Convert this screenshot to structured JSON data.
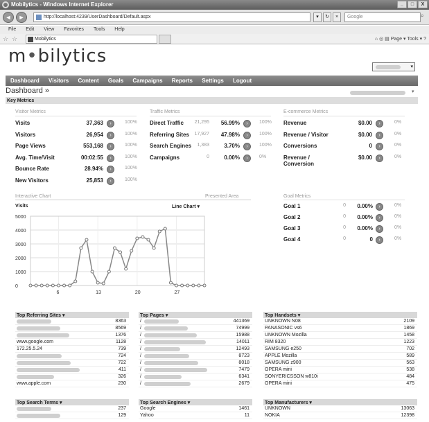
{
  "window": {
    "title": "Mobilytics - Windows Internet Explorer",
    "min": "_",
    "max": "□",
    "close": "X"
  },
  "address": {
    "url": "http://localhost:4239/UserDashboard/Default.aspx",
    "search_placeholder": "Google",
    "back": "◄",
    "fwd": "►"
  },
  "menu": [
    "File",
    "Edit",
    "View",
    "Favorites",
    "Tools",
    "Help"
  ],
  "tab": {
    "label": "Mobilytics"
  },
  "toolbar_right": "Page ▾  Tools ▾",
  "brand": {
    "logo_pre": "m",
    "logo_dot": "•",
    "logo_post": "bilytics"
  },
  "nav": [
    "Dashboard",
    "Visitors",
    "Content",
    "Goals",
    "Campaigns",
    "Reports",
    "Settings",
    "Logout"
  ],
  "breadcrumb": "Dashboard »",
  "key_metrics": "Key Metrics",
  "visitor": {
    "heading": "Visitor Metrics",
    "rows": [
      {
        "label": "Visits",
        "value": "37,363",
        "pct": "100%"
      },
      {
        "label": "Visitors",
        "value": "26,954",
        "pct": "100%"
      },
      {
        "label": "Page Views",
        "value": "553,168",
        "pct": "100%"
      },
      {
        "label": "Avg. Time/Visit",
        "value": "00:02:55",
        "pct": "100%"
      },
      {
        "label": "Bounce Rate",
        "value": "28.94%",
        "pct": "100%"
      },
      {
        "label": "New Visitors",
        "value": "25,853",
        "pct": "100%"
      }
    ]
  },
  "traffic": {
    "heading": "Traffic Metrics",
    "rows": [
      {
        "label": "Direct Traffic",
        "mini": "21,295",
        "value": "56.99%",
        "pct": "100%"
      },
      {
        "label": "Referring Sites",
        "mini": "17,927",
        "value": "47.98%",
        "pct": "100%"
      },
      {
        "label": "Search Engines",
        "mini": "1,383",
        "value": "3.70%",
        "pct": "100%"
      },
      {
        "label": "Campaigns",
        "mini": "0",
        "value": "0.00%",
        "pct": "0%"
      }
    ]
  },
  "ecom": {
    "heading": "E-commerce Metrics",
    "rows": [
      {
        "label": "Revenue",
        "value": "$0.00",
        "pct": "0%"
      },
      {
        "label": "Revenue / Visitor",
        "value": "$0.00",
        "pct": "0%"
      },
      {
        "label": "Conversions",
        "value": "0",
        "pct": "0%"
      },
      {
        "label": "Revenue / Conversion",
        "value": "$0.00",
        "pct": "0%"
      }
    ]
  },
  "goals": {
    "heading": "Goal Metrics",
    "rows": [
      {
        "label": "Goal 1",
        "mini": "0",
        "value": "0.00%",
        "pct": "0%"
      },
      {
        "label": "Goal 2",
        "mini": "0",
        "value": "0.00%",
        "pct": "0%"
      },
      {
        "label": "Goal 3",
        "mini": "0",
        "value": "0.00%",
        "pct": "0%"
      },
      {
        "label": "Goal 4",
        "mini": "0",
        "value": "0",
        "pct": "0%"
      }
    ]
  },
  "chart_header": {
    "title": "Interactive Chart",
    "highlight": "Presented Area",
    "metric": "Visits",
    "type_label": "Line Chart ▾"
  },
  "chart_data": {
    "type": "line",
    "series_label": "Visits",
    "x": [
      1,
      2,
      3,
      4,
      5,
      6,
      7,
      8,
      9,
      10,
      11,
      12,
      13,
      14,
      15,
      16,
      17,
      18,
      19,
      20,
      21,
      22,
      23,
      24,
      25,
      26,
      27,
      28,
      29,
      30,
      31,
      32
    ],
    "values": [
      0,
      0,
      0,
      0,
      0,
      0,
      0,
      0,
      300,
      2700,
      3300,
      1000,
      200,
      150,
      1000,
      2700,
      2400,
      1200,
      2500,
      3400,
      3500,
      3300,
      2700,
      3900,
      4100,
      200,
      0,
      0,
      0,
      0,
      0,
      0
    ],
    "x_ticks": [
      "6",
      "13",
      "20",
      "27"
    ],
    "y_ticks": [
      "5000",
      "4000",
      "3000",
      "2000",
      "1000",
      "0"
    ],
    "ylim": [
      0,
      5000
    ]
  },
  "tables": {
    "referring": {
      "title": "Top Referring Sites ▾",
      "rows": [
        {
          "name": "",
          "value": "8363"
        },
        {
          "name": "",
          "value": "8569"
        },
        {
          "name": "",
          "value": "1376"
        },
        {
          "name": "www.google.com",
          "value": "1128"
        },
        {
          "name": "172.25.5.24",
          "value": "739"
        },
        {
          "name": "",
          "value": "724"
        },
        {
          "name": "",
          "value": "722"
        },
        {
          "name": "",
          "value": "411"
        },
        {
          "name": "",
          "value": "326"
        },
        {
          "name": "www.apple.com",
          "value": "230"
        }
      ]
    },
    "pages": {
      "title": "Top Pages ▾",
      "rows": [
        {
          "name": "/",
          "value": "441369"
        },
        {
          "name": "/",
          "value": "74999"
        },
        {
          "name": "/",
          "value": "15988"
        },
        {
          "name": "/",
          "value": "14011"
        },
        {
          "name": "/",
          "value": "12493"
        },
        {
          "name": "/",
          "value": "8723"
        },
        {
          "name": "/",
          "value": "8018"
        },
        {
          "name": "/",
          "value": "7479"
        },
        {
          "name": "/",
          "value": "6341"
        },
        {
          "name": "/",
          "value": "2679"
        }
      ]
    },
    "handsets": {
      "title": "Top Handsets ▾",
      "rows": [
        {
          "name": "UNKNOWN N08",
          "value": "2109"
        },
        {
          "name": "PANASONIC vs6",
          "value": "1869"
        },
        {
          "name": "UNKNOWN Mozilla",
          "value": "1458"
        },
        {
          "name": "RIM 8320",
          "value": "1223"
        },
        {
          "name": "SAMSUNG e250",
          "value": "702"
        },
        {
          "name": "APPLE Mozilla",
          "value": "589"
        },
        {
          "name": "SAMSUNG z900",
          "value": "563"
        },
        {
          "name": "OPERA mini",
          "value": "538"
        },
        {
          "name": "SONYERICSSON w810i",
          "value": "484"
        },
        {
          "name": "OPERA mini",
          "value": "475"
        }
      ]
    },
    "search_terms": {
      "title": "Top Search Terms ▾",
      "rows": [
        {
          "name": "",
          "value": "237"
        },
        {
          "name": "",
          "value": "129"
        }
      ]
    },
    "search_engines": {
      "title": "Top Search Engines ▾",
      "rows": [
        {
          "name": "Google",
          "value": "1461"
        },
        {
          "name": "Yahoo",
          "value": "11"
        }
      ]
    },
    "manufacturers": {
      "title": "Top Manufacturers ▾",
      "rows": [
        {
          "name": "UNKNOWN",
          "value": "13063"
        },
        {
          "name": "NOKIA",
          "value": "12398"
        }
      ]
    }
  }
}
